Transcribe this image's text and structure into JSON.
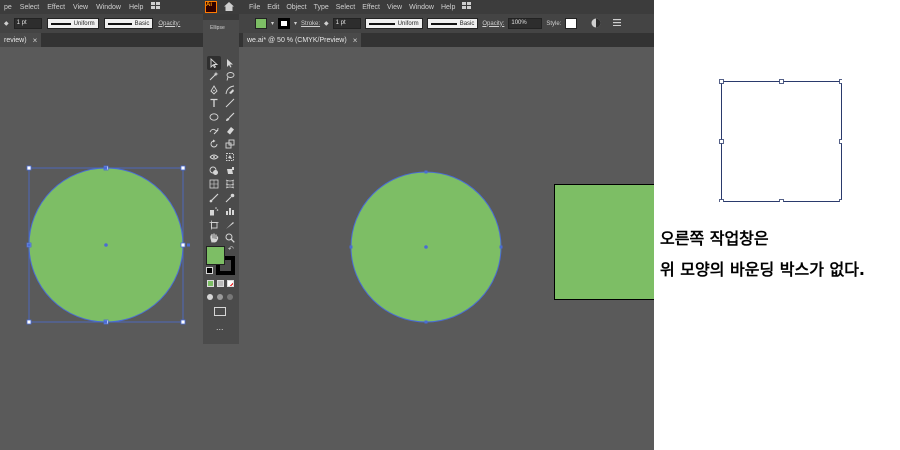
{
  "left_window": {
    "menu": [
      "pe",
      "Select",
      "Effect",
      "View",
      "Window",
      "Help"
    ],
    "control": {
      "stroke_weight": "1 pt",
      "stroke_profile": "Uniform",
      "brush": "Basic",
      "opacity_label": "Opacity:"
    },
    "tab_label": "review)",
    "tab_close": "×"
  },
  "right_window": {
    "app_logo": "Ai",
    "menu": [
      "File",
      "Edit",
      "Object",
      "Type",
      "Select",
      "Effect",
      "View",
      "Window",
      "Help"
    ],
    "control": {
      "selection_label": "Ellipse",
      "stroke_label": "Stroke:",
      "stroke_weight": "1 pt",
      "stroke_profile": "Uniform",
      "brush": "Basic",
      "opacity_label": "Opacity:",
      "opacity_value": "100%",
      "style_label": "Style:"
    },
    "tab_label": "we.ai* @ 50 % (CMYK/Preview)",
    "tab_close": "×",
    "fill_color": "#7dbe65",
    "stroke_color": "#000000"
  },
  "toolbar": {
    "tools": [
      "selection-tool-icon",
      "direct-selection-tool-icon",
      "magic-wand-tool-icon",
      "lasso-tool-icon",
      "pen-tool-icon",
      "curvature-tool-icon",
      "type-tool-icon",
      "line-segment-tool-icon",
      "ellipse-tool-icon",
      "paintbrush-tool-icon",
      "shaper-tool-icon",
      "eraser-tool-icon",
      "rotate-tool-icon",
      "scale-tool-icon",
      "width-tool-icon",
      "free-transform-tool-icon",
      "shape-builder-tool-icon",
      "live-paint-tool-icon",
      "perspective-grid-tool-icon",
      "mesh-tool-icon",
      "gradient-tool-icon",
      "eyedropper-tool-icon",
      "symbol-sprayer-tool-icon",
      "column-graph-tool-icon",
      "artboard-tool-icon",
      "slice-tool-icon",
      "hand-tool-icon",
      "zoom-tool-icon"
    ],
    "more_tools": "..."
  },
  "colors": {
    "shape_fill": "#7dbe65",
    "bounding_box": "#4a6cd4",
    "canvas": "#5a5a5a"
  },
  "note": {
    "line1": "오른쪽 작업창은",
    "line2": "위 모양의 바운딩 박스가 없다."
  }
}
